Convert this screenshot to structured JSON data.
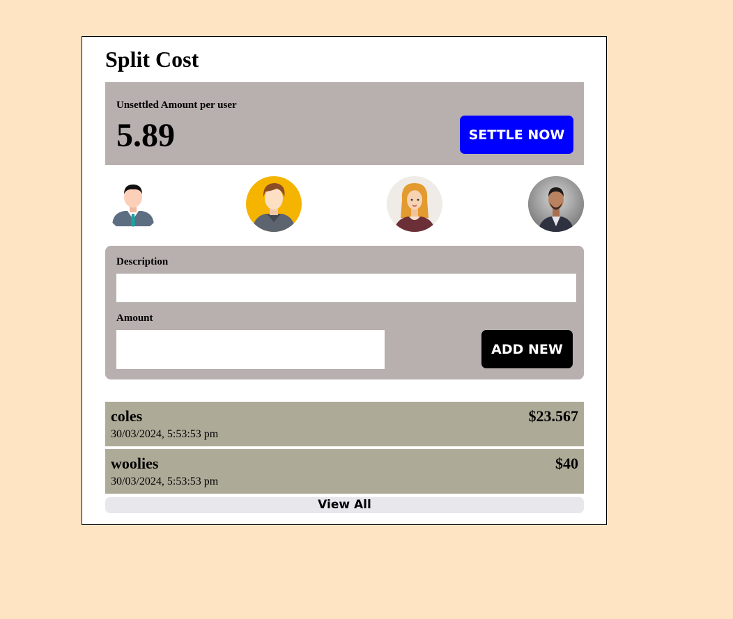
{
  "app": {
    "title": "Split Cost"
  },
  "summary": {
    "label": "Unsettled Amount per user",
    "amount": "5.89",
    "settle_label": "SETTLE NOW",
    "settle_color": "#0000FF"
  },
  "users": [
    {
      "icon": "businessman-avatar-icon"
    },
    {
      "icon": "young-man-avatar-icon"
    },
    {
      "icon": "woman-avatar-icon"
    },
    {
      "icon": "man-photo-avatar-icon"
    }
  ],
  "form": {
    "description_label": "Description",
    "description_value": "",
    "amount_label": "Amount",
    "amount_value": "",
    "add_label": "ADD NEW"
  },
  "expenses": [
    {
      "name": "coles",
      "amount": "$23.567",
      "date": "30/03/2024, 5:53:53 pm"
    },
    {
      "name": "woolies",
      "amount": "$40",
      "date": "30/03/2024, 5:53:53 pm"
    }
  ],
  "view_all_label": "View All",
  "colors": {
    "page_background": "#FFE4C4",
    "panel": "#B8AFAF",
    "expense_row": "#AEAA98",
    "add_button": "#000000"
  }
}
